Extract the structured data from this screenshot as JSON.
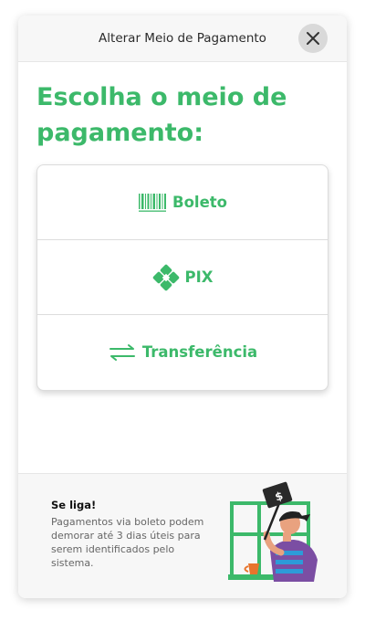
{
  "header": {
    "title": "Alterar Meio de Pagamento",
    "close_icon": "close-icon"
  },
  "main": {
    "heading": "Escolha o meio de pagamento:",
    "options": [
      {
        "label": "Boleto",
        "icon": "barcode-icon"
      },
      {
        "label": "PIX",
        "icon": "pix-icon"
      },
      {
        "label": "Transferência",
        "icon": "transfer-arrows-icon"
      }
    ]
  },
  "footer": {
    "tip_title": "Se liga!",
    "tip_text": "Pagamentos via boleto podem demorar até 3 dias úteis para serem identificados pelo sistema.",
    "illustration_icon": "person-holding-dollar-sign-illustration",
    "illustration_sign": "$"
  },
  "colors": {
    "accent": "#3cb96a",
    "header_bg": "#f7f7f7",
    "close_bg": "#d9d9d9"
  }
}
